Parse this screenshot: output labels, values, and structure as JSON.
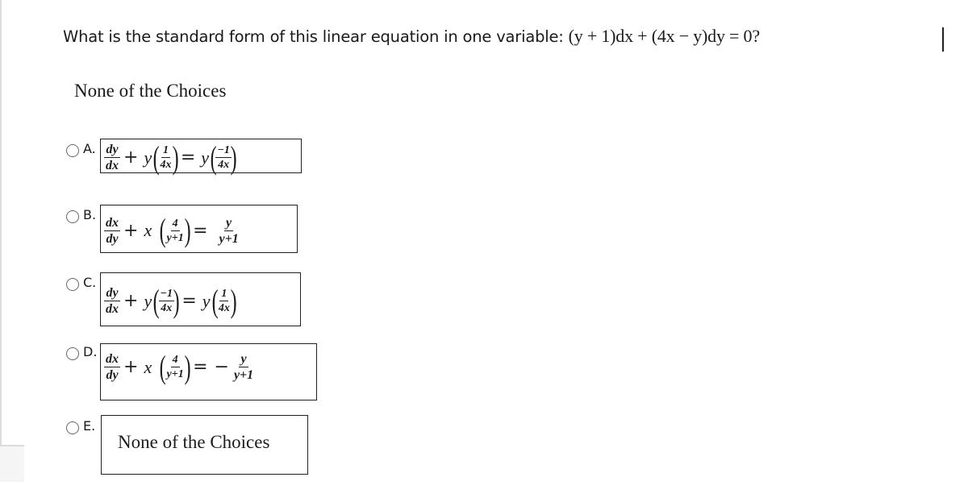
{
  "question": {
    "text": "What is the standard form of this linear equation in one variable: ",
    "equation": "(y + 1)dx + (4x − y)dy = 0?"
  },
  "selected_answer_text": "None of the Choices",
  "options": [
    {
      "letter": "A.",
      "lhs_frac": {
        "num": "dy",
        "den": "dx"
      },
      "plus": "+",
      "var": "y",
      "lhs_coef": {
        "num": "1",
        "den": "4x"
      },
      "equals": "=",
      "rhs_var": "y",
      "rhs_coef": {
        "num": "−1",
        "den": "4x"
      },
      "latex": "\\frac{dy}{dx} + y\\left(\\frac{1}{4x}\\right) = y\\left(\\frac{-1}{4x}\\right)"
    },
    {
      "letter": "B.",
      "lhs_frac": {
        "num": "dx",
        "den": "dy"
      },
      "plus": "+",
      "var": "x",
      "lhs_coef": {
        "num": "4",
        "den": "y+1"
      },
      "equals": "=",
      "rhs_sign": "",
      "rhs_frac": {
        "num": "y",
        "den": "y+1"
      },
      "latex": "\\frac{dx}{dy} + x\\left(\\frac{4}{y+1}\\right) = \\frac{y}{y+1}"
    },
    {
      "letter": "C.",
      "lhs_frac": {
        "num": "dy",
        "den": "dx"
      },
      "plus": "+",
      "var": "y",
      "lhs_coef": {
        "num": "−1",
        "den": "4x"
      },
      "equals": "=",
      "rhs_var": "y",
      "rhs_coef": {
        "num": "1",
        "den": "4x"
      },
      "latex": "\\frac{dy}{dx} + y\\left(\\frac{-1}{4x}\\right) = y\\left(\\frac{1}{4x}\\right)"
    },
    {
      "letter": "D.",
      "lhs_frac": {
        "num": "dx",
        "den": "dy"
      },
      "plus": "+",
      "var": "x",
      "lhs_coef": {
        "num": "4",
        "den": "y+1"
      },
      "equals": "=",
      "rhs_sign": "−",
      "rhs_frac": {
        "num": "y",
        "den": "y+1"
      },
      "latex": "\\frac{dx}{dy} + x\\left(\\frac{4}{y+1}\\right) = -\\frac{y}{y+1}"
    },
    {
      "letter": "E.",
      "text": "None of the Choices"
    }
  ]
}
